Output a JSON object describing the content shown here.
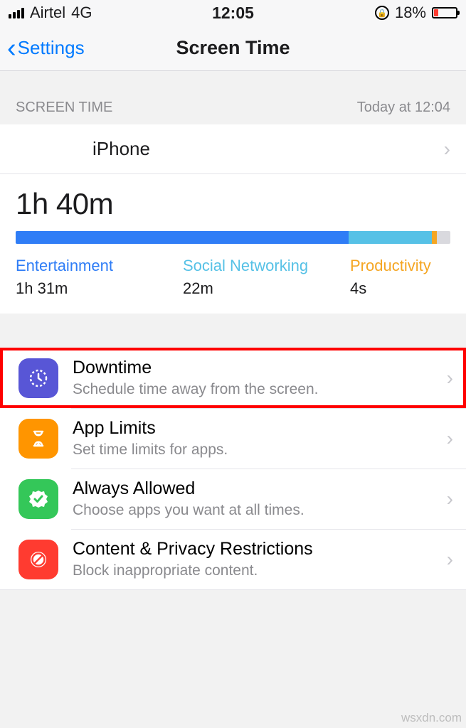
{
  "status": {
    "carrier": "Airtel",
    "network": "4G",
    "time": "12:05",
    "battery_percent": "18%"
  },
  "nav": {
    "back_label": "Settings",
    "title": "Screen Time"
  },
  "screentime": {
    "header_label": "SCREEN TIME",
    "timestamp": "Today at 12:04",
    "device": "iPhone",
    "total": "1h 40m",
    "categories": {
      "entertainment": {
        "label": "Entertainment",
        "time": "1h 31m"
      },
      "social": {
        "label": "Social Networking",
        "time": "22m"
      },
      "productivity": {
        "label": "Productivity",
        "time": "4s"
      }
    }
  },
  "menu": {
    "downtime": {
      "title": "Downtime",
      "subtitle": "Schedule time away from the screen."
    },
    "applimits": {
      "title": "App Limits",
      "subtitle": "Set time limits for apps."
    },
    "always": {
      "title": "Always Allowed",
      "subtitle": "Choose apps you want at all times."
    },
    "content": {
      "title": "Content & Privacy Restrictions",
      "subtitle": "Block inappropriate content."
    }
  },
  "watermark": "wsxdn.com",
  "chart_data": {
    "type": "bar",
    "title": "Screen Time usage breakdown",
    "categories": [
      "Entertainment",
      "Social Networking",
      "Productivity"
    ],
    "values_minutes": [
      91,
      22,
      0.07
    ],
    "display_values": [
      "1h 31m",
      "22m",
      "4s"
    ],
    "total_display": "1h 40m",
    "colors": [
      "#2f7df6",
      "#56c1e6",
      "#f5a623"
    ]
  }
}
